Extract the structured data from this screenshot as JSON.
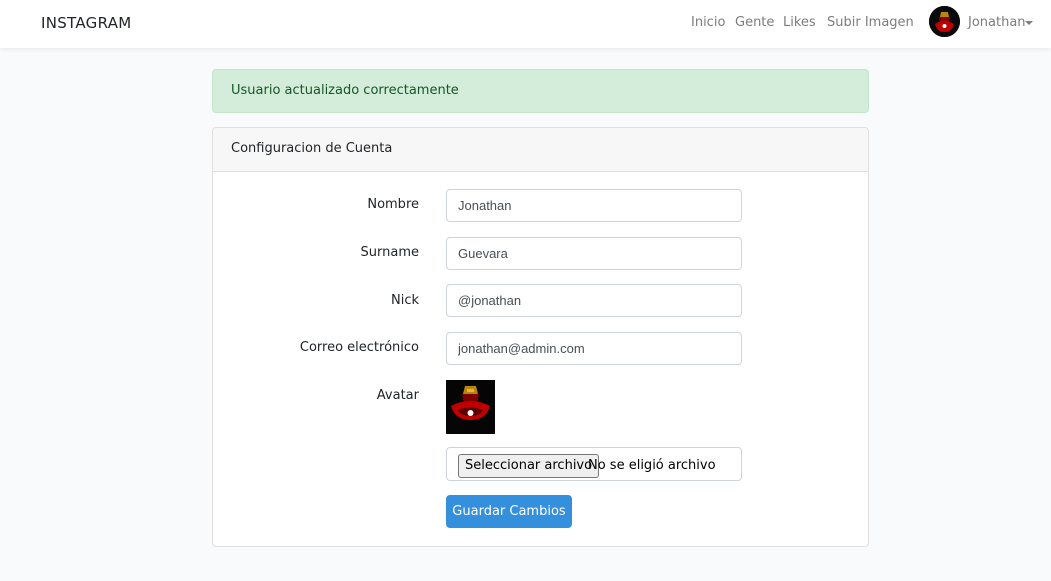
{
  "navbar": {
    "brand": "INSTAGRAM",
    "links": [
      "Inicio",
      "Gente",
      "Likes",
      "Subir Imagen"
    ],
    "user": "Jonathan"
  },
  "alert": {
    "message": "Usuario actualizado correctamente"
  },
  "card": {
    "title": "Configuracion de Cuenta",
    "fields": {
      "name": {
        "label": "Nombre",
        "value": "Jonathan"
      },
      "surname": {
        "label": "Surname",
        "value": "Guevara"
      },
      "nick": {
        "label": "Nick",
        "value": "@jonathan"
      },
      "email": {
        "label": "Correo electrónico",
        "value": "jonathan@admin.com"
      }
    },
    "avatar": {
      "label": "Avatar",
      "file_button": "Seleccionar archivo",
      "file_status": "No se eligió archivo"
    },
    "save_label": "Guardar Cambios"
  },
  "colors": {
    "primary": "#3490dc",
    "alert_bg": "#d4edda",
    "alert_text": "#155724",
    "nav_link": "#7d7d7d"
  },
  "icons": {
    "dropdown": "caret-down-icon"
  }
}
